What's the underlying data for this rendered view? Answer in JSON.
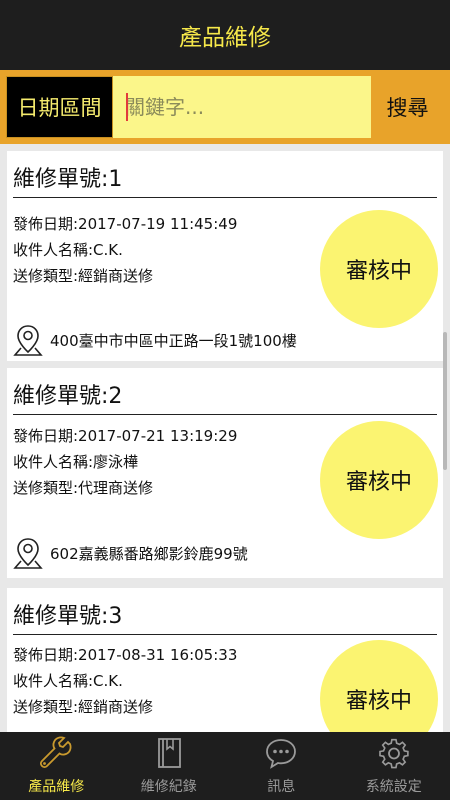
{
  "header": {
    "title": "產品維修"
  },
  "search": {
    "date_label": "日期區間",
    "placeholder": "關鍵字...",
    "button_label": "搜尋"
  },
  "orders": [
    {
      "title": "維修單號:1",
      "date": "發佈日期:2017-07-19 11:45:49",
      "recipient": "收件人名稱:C.K.",
      "type": "送修類型:經銷商送修",
      "status": "審核中",
      "address": "400臺中市中區中正路一段1號100樓"
    },
    {
      "title": "維修單號:2",
      "date": "發佈日期:2017-07-21 13:19:29",
      "recipient": "收件人名稱:廖泳樺",
      "type": "送修類型:代理商送修",
      "status": "審核中",
      "address": "602嘉義縣番路鄉影鈴鹿99號"
    },
    {
      "title": "維修單號:3",
      "date": "發佈日期:2017-08-31 16:05:33",
      "recipient": "收件人名稱:C.K.",
      "type": "送修類型:經銷商送修",
      "status": "審核中",
      "address": ""
    }
  ],
  "nav": [
    {
      "label": "產品維修",
      "icon": "wrench-icon",
      "active": true
    },
    {
      "label": "維修紀錄",
      "icon": "book-icon",
      "active": false
    },
    {
      "label": "訊息",
      "icon": "chat-icon",
      "active": false
    },
    {
      "label": "系統設定",
      "icon": "gear-icon",
      "active": false
    }
  ],
  "colors": {
    "header_bg": "#1e1e1e",
    "accent_yellow": "#f6e84a",
    "search_bar": "#e8a32a",
    "status_circle": "#fbf471"
  }
}
